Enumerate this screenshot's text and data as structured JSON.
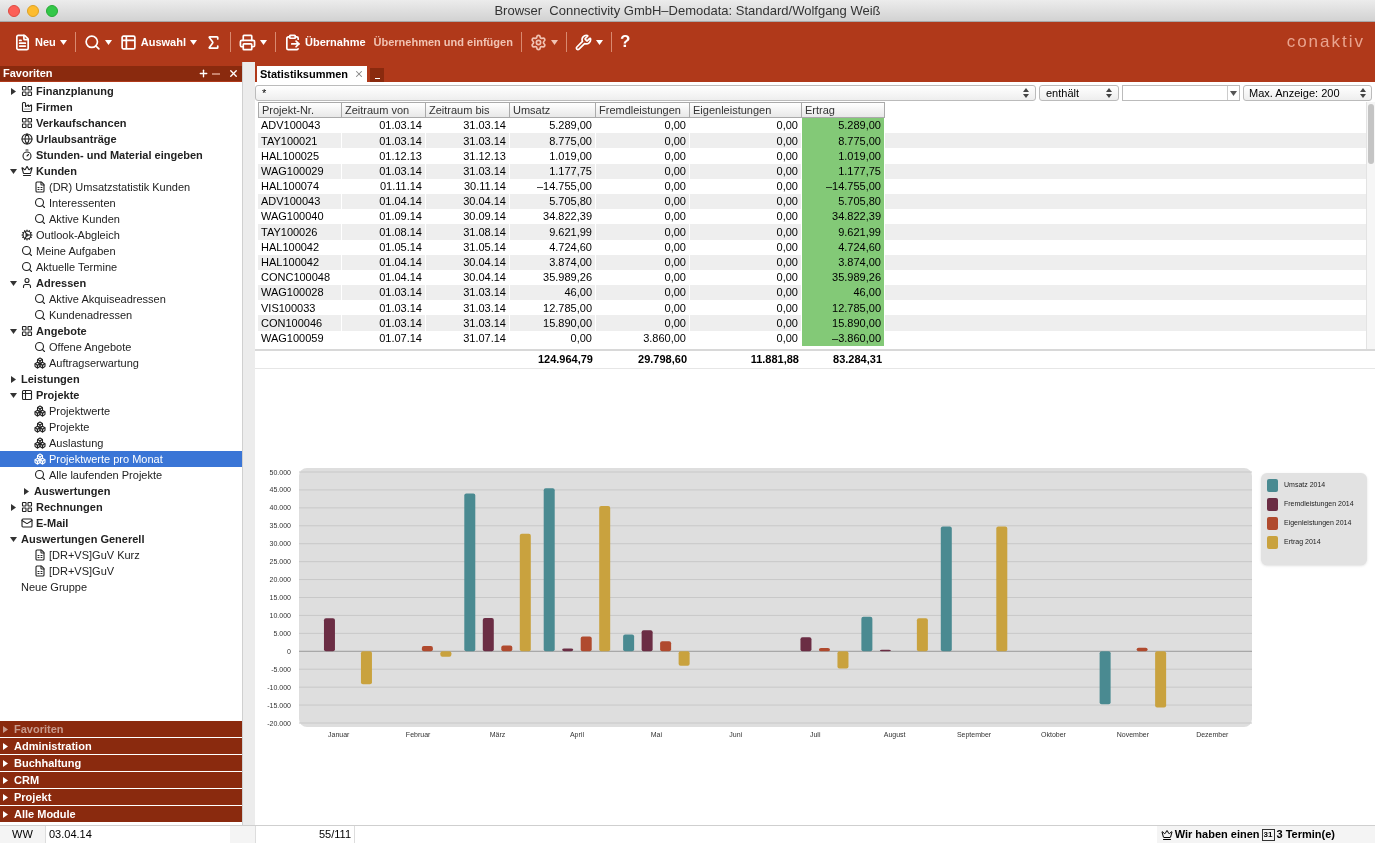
{
  "window": {
    "title": "Browser  Connectivity GmbH–Demodata: Standard/Wolfgang Weiß"
  },
  "toolbar": [
    {
      "kind": "new",
      "label": "Neu",
      "has_menu": true,
      "disabled": false
    },
    {
      "kind": "search",
      "has_menu": true,
      "disabled": false
    },
    {
      "kind": "select",
      "label": "Auswahl",
      "has_menu": true,
      "disabled": false
    },
    {
      "kind": "sum",
      "has_menu": false,
      "disabled": false
    },
    {
      "kind": "print",
      "has_menu": true,
      "disabled": false
    },
    {
      "kind": "takeover",
      "label": "Übernahme",
      "has_menu": false,
      "disabled": false
    },
    {
      "kind": "insert",
      "label": "Übernehmen und einfügen",
      "has_menu": false,
      "disabled": true
    },
    {
      "kind": "settings",
      "has_menu": true,
      "disabled": true
    },
    {
      "kind": "tools",
      "has_menu": true,
      "disabled": false
    },
    {
      "kind": "help",
      "label": "?",
      "has_menu": false,
      "disabled": false
    }
  ],
  "logo": "conaktiv",
  "sidebar": {
    "title": "Favoriten",
    "tree": [
      {
        "label": "Finanzplanung",
        "kind": "grid",
        "bold": true,
        "expanded": false,
        "selected": false
      },
      {
        "label": "Firmen",
        "kind": "factory",
        "bold": true,
        "selected": false
      },
      {
        "label": "Verkaufschancen",
        "kind": "grid",
        "bold": true,
        "selected": false
      },
      {
        "label": "Urlaubsanträge",
        "kind": "ball",
        "bold": true,
        "selected": false
      },
      {
        "label": "Stunden- und Material eingeben",
        "kind": "timer",
        "bold": true,
        "selected": false
      },
      {
        "label": "Kunden",
        "kind": "crown",
        "bold": true,
        "expanded": true,
        "selected": false,
        "children": [
          {
            "label": "(DR) Umsatzstatistik Kunden",
            "kind": "report",
            "bold": false,
            "selected": false
          },
          {
            "label": "Interessenten",
            "kind": "search",
            "bold": false,
            "selected": false
          },
          {
            "label": "Aktive Kunden",
            "kind": "search",
            "bold": false,
            "selected": false
          }
        ]
      },
      {
        "label": "Outlook-Abgleich",
        "kind": "gear",
        "bold": false,
        "selected": false
      },
      {
        "label": "Meine Aufgaben",
        "kind": "search",
        "bold": false,
        "selected": false
      },
      {
        "label": "Aktuelle Termine",
        "kind": "search",
        "bold": false,
        "selected": false
      },
      {
        "label": "Adressen",
        "kind": "head",
        "bold": true,
        "expanded": true,
        "selected": false,
        "children": [
          {
            "label": "Aktive Akquiseadressen",
            "kind": "search",
            "bold": false,
            "selected": false
          },
          {
            "label": "Kundenadressen",
            "kind": "search",
            "bold": false,
            "selected": false
          }
        ]
      },
      {
        "label": "Angebote",
        "kind": "grid",
        "bold": true,
        "expanded": true,
        "selected": false,
        "children": [
          {
            "label": "Offene Angebote",
            "kind": "search",
            "bold": false,
            "selected": false
          },
          {
            "label": "Auftragserwartung",
            "kind": "cubes",
            "bold": false,
            "selected": false
          }
        ]
      },
      {
        "label": "Leistungen",
        "kind": "none",
        "bold": true,
        "expanded": false,
        "selected": false
      },
      {
        "label": "Projekte",
        "kind": "table",
        "bold": true,
        "expanded": true,
        "selected": false,
        "children": [
          {
            "label": "Projektwerte",
            "kind": "cubes",
            "bold": false,
            "selected": false
          },
          {
            "label": "Projekte",
            "kind": "cubes",
            "bold": false,
            "selected": false
          },
          {
            "label": "Auslastung",
            "kind": "cubes",
            "bold": false,
            "selected": false
          },
          {
            "label": "Projektwerte pro Monat",
            "kind": "cubes",
            "bold": false,
            "selected": true
          },
          {
            "label": "Alle laufenden Projekte",
            "kind": "search",
            "bold": false,
            "selected": false
          },
          {
            "label": "Auswertungen",
            "kind": "none",
            "bold": true,
            "expanded": false,
            "selected": false
          }
        ]
      },
      {
        "label": "Rechnungen",
        "kind": "grid",
        "bold": true,
        "expanded": false,
        "selected": false
      },
      {
        "label": "E-Mail",
        "kind": "mail",
        "bold": true,
        "selected": false
      },
      {
        "label": "Auswertungen Generell",
        "kind": "none",
        "bold": true,
        "expanded": true,
        "selected": false,
        "children": [
          {
            "label": "[DR+VS]GuV Kurz",
            "kind": "report",
            "bold": false,
            "selected": false
          },
          {
            "label": "[DR+VS]GuV",
            "kind": "report",
            "bold": false,
            "selected": false
          }
        ]
      },
      {
        "label": "Neue Gruppe",
        "kind": "none",
        "bold": false,
        "selected": false
      }
    ],
    "modules": [
      {
        "label": "Favoriten",
        "selected": true
      },
      {
        "label": "Administration",
        "selected": false
      },
      {
        "label": "Buchhaltung",
        "selected": false
      },
      {
        "label": "CRM",
        "selected": false
      },
      {
        "label": "Projekt",
        "selected": false
      },
      {
        "label": "Alle Module",
        "selected": false
      }
    ]
  },
  "tabs": [
    {
      "label": "Statistiksummen",
      "selected": true
    }
  ],
  "filter": {
    "value": "*",
    "operator": "enthält",
    "max": "Max. Anzeige: 200"
  },
  "table": {
    "columns": [
      "Projekt-Nr.",
      "Zeitraum von",
      "Zeitraum bis",
      "Umsatz",
      "Fremdleistungen",
      "Eigenleistungen",
      "Ertrag"
    ],
    "rows": [
      [
        "ADV100043",
        "01.03.14",
        "31.03.14",
        "5.289,00",
        "0,00",
        "0,00",
        "5.289,00"
      ],
      [
        "TAY100021",
        "01.03.14",
        "31.03.14",
        "8.775,00",
        "0,00",
        "0,00",
        "8.775,00"
      ],
      [
        "HAL100025",
        "01.12.13",
        "31.12.13",
        "1.019,00",
        "0,00",
        "0,00",
        "1.019,00"
      ],
      [
        "WAG100029",
        "01.03.14",
        "31.03.14",
        "1.177,75",
        "0,00",
        "0,00",
        "1.177,75"
      ],
      [
        "HAL100074",
        "01.11.14",
        "30.11.14",
        "–14.755,00",
        "0,00",
        "0,00",
        "–14.755,00"
      ],
      [
        "ADV100043",
        "01.04.14",
        "30.04.14",
        "5.705,80",
        "0,00",
        "0,00",
        "5.705,80"
      ],
      [
        "WAG100040",
        "01.09.14",
        "30.09.14",
        "34.822,39",
        "0,00",
        "0,00",
        "34.822,39"
      ],
      [
        "TAY100026",
        "01.08.14",
        "31.08.14",
        "9.621,99",
        "0,00",
        "0,00",
        "9.621,99"
      ],
      [
        "HAL100042",
        "01.05.14",
        "31.05.14",
        "4.724,60",
        "0,00",
        "0,00",
        "4.724,60"
      ],
      [
        "HAL100042",
        "01.04.14",
        "30.04.14",
        "3.874,00",
        "0,00",
        "0,00",
        "3.874,00"
      ],
      [
        "CONC100048",
        "01.04.14",
        "30.04.14",
        "35.989,26",
        "0,00",
        "0,00",
        "35.989,26"
      ],
      [
        "WAG100028",
        "01.03.14",
        "31.03.14",
        "46,00",
        "0,00",
        "0,00",
        "46,00"
      ],
      [
        "VIS100033",
        "01.03.14",
        "31.03.14",
        "12.785,00",
        "0,00",
        "0,00",
        "12.785,00"
      ],
      [
        "CON100046",
        "01.03.14",
        "31.03.14",
        "15.890,00",
        "0,00",
        "0,00",
        "15.890,00"
      ],
      [
        "WAG100059",
        "01.07.14",
        "31.07.14",
        "0,00",
        "3.860,00",
        "0,00",
        "–3.860,00"
      ]
    ],
    "totals": [
      "124.964,79",
      "29.798,60",
      "11.881,88",
      "83.284,31"
    ]
  },
  "chart_data": {
    "type": "bar",
    "categories": [
      "Januar",
      "Februar",
      "März",
      "April",
      "Mai",
      "Juni",
      "Juli",
      "August",
      "September",
      "Oktober",
      "November",
      "Dezember"
    ],
    "series": [
      {
        "name": "Umsatz 2014",
        "color": "#4a8a91",
        "values": [
          0,
          0,
          44000,
          45500,
          4700,
          0,
          0,
          9600,
          34800,
          0,
          -14800,
          0
        ]
      },
      {
        "name": "Fremdleistungen 2014",
        "color": "#6b2d44",
        "values": [
          9200,
          0,
          9300,
          800,
          5900,
          0,
          3900,
          400,
          0,
          0,
          0,
          0
        ]
      },
      {
        "name": "Eigenleistungen 2014",
        "color": "#b04a2e",
        "values": [
          0,
          1500,
          1600,
          4100,
          2800,
          0,
          900,
          0,
          0,
          0,
          1000,
          0
        ]
      },
      {
        "name": "Ertrag 2014",
        "color": "#c9a23e",
        "values": [
          -9200,
          -1500,
          32800,
          40500,
          -4000,
          0,
          -4800,
          9200,
          34800,
          0,
          -15700,
          0
        ]
      }
    ],
    "ylim": [
      -20000,
      50000
    ],
    "grid": true,
    "yticks": [
      {
        "value": 50000,
        "label": "50.000"
      },
      {
        "value": 45000,
        "label": "45.000"
      },
      {
        "value": 40000,
        "label": "40.000"
      },
      {
        "value": 35000,
        "label": "35.000"
      },
      {
        "value": 30000,
        "label": "30.000"
      },
      {
        "value": 25000,
        "label": "25.000"
      },
      {
        "value": 20000,
        "label": "20.000"
      },
      {
        "value": 15000,
        "label": "15.000"
      },
      {
        "value": 10000,
        "label": "10.000"
      },
      {
        "value": 5000,
        "label": "5.000"
      },
      {
        "value": 0,
        "label": "0"
      },
      {
        "value": -5000,
        "label": "-5.000"
      },
      {
        "value": -10000,
        "label": "-10.000"
      },
      {
        "value": -15000,
        "label": "-15.000"
      },
      {
        "value": -20000,
        "label": "-20.000"
      }
    ]
  },
  "status_bar": {
    "user": "WW",
    "date": "03.04.14",
    "count": "55/111",
    "message": "Wir haben einen",
    "calendar_day": "31",
    "appointments": "3 Termin(e)"
  }
}
